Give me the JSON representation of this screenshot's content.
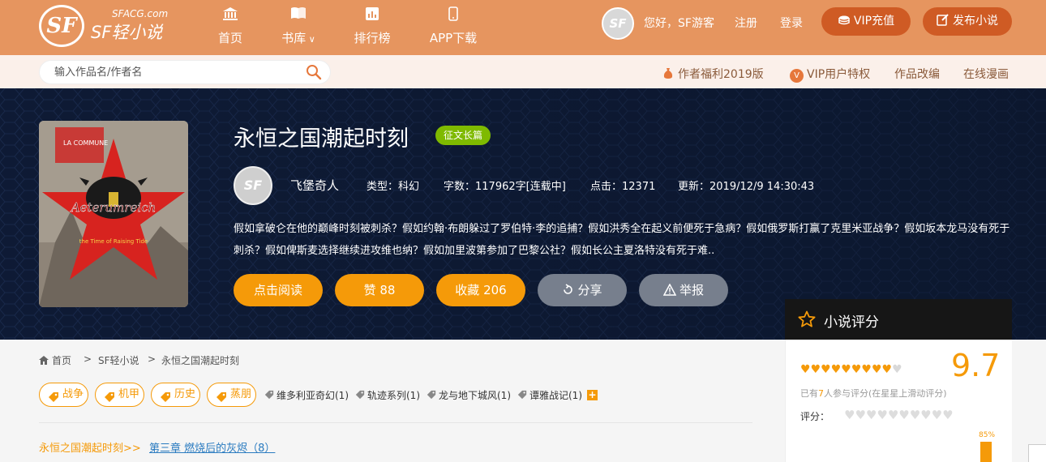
{
  "header": {
    "logo_small": "SFACG.com",
    "logo_big": "SF轻小说",
    "logo_mark": "SF",
    "nav": [
      {
        "label": "首页",
        "icon": "bank-icon"
      },
      {
        "label": "书库",
        "icon": "book-icon"
      },
      {
        "label": "排行榜",
        "icon": "bar-chart-icon"
      },
      {
        "label": "APP下载",
        "icon": "phone-icon"
      }
    ],
    "avatar_mark": "SF",
    "greeting": "您好，SF游客",
    "register": "注册",
    "login": "登录",
    "vip_button": "VIP充值",
    "publish_button": "发布小说"
  },
  "subbar": {
    "search_placeholder": "输入作品名/作者名",
    "links": [
      "作者福利2019版",
      "VIP用户特权",
      "作品改编",
      "在线漫画"
    ]
  },
  "book": {
    "title": "永恒之国潮起时刻",
    "badge": "征文长篇",
    "cover_text": "Aeterumreich",
    "cover_subtext": "the Time of Raising Tide",
    "author": "飞堡奇人",
    "author_avatar_mark": "SF",
    "type": "类型：科幻",
    "words": "字数：117962字[连载中]",
    "clicks": "点击：12371",
    "updated": "更新：2019/12/9 14:30:43",
    "description": "假如拿破仑在他的巅峰时刻被刺杀？假如约翰·布朗躲过了罗伯特·李的追捕？假如洪秀全在起义前便死于急病？假如俄罗斯打赢了克里米亚战争？假如坂本龙马没有死于刺杀？假如俾斯麦选择继续进攻维也纳？假如加里波第参加了巴黎公社？假如长公主夏洛特没有死于难..",
    "actions": {
      "read": "点击阅读",
      "like": "赞 88",
      "collect": "收藏 206",
      "share": "分享",
      "report": "举报"
    }
  },
  "rating": {
    "title": "小说评分",
    "score": "9.7",
    "hearts_filled": 9,
    "hearts_total": 10,
    "count_prefix": "已有",
    "count": "7",
    "count_suffix": "人参与评分(在星星上滑动评分)",
    "rate_label": "评分：",
    "bar_percent": "85%",
    "bar_fraction": 0.85
  },
  "breadcrumb": [
    "首页",
    ">",
    "SF轻小说",
    ">",
    "永恒之国潮起时刻"
  ],
  "tags_primary": [
    "战争",
    "机甲",
    "历史",
    "蒸朋"
  ],
  "tags_secondary": [
    "维多利亚奇幻(1)",
    "轨迹系列(1)",
    "龙与地下城风(1)",
    "谭雅战记(1)"
  ],
  "plus_label": "+",
  "chapter": {
    "book_link": "永恒之国潮起时刻>>",
    "chapter_link": "第三章 燃烧后的灰烬（8）"
  },
  "colors": {
    "header_orange": "#e6955f",
    "accent": "#f59a09",
    "badge_green": "#7fba00",
    "banner_dark": "#0e1a33"
  }
}
